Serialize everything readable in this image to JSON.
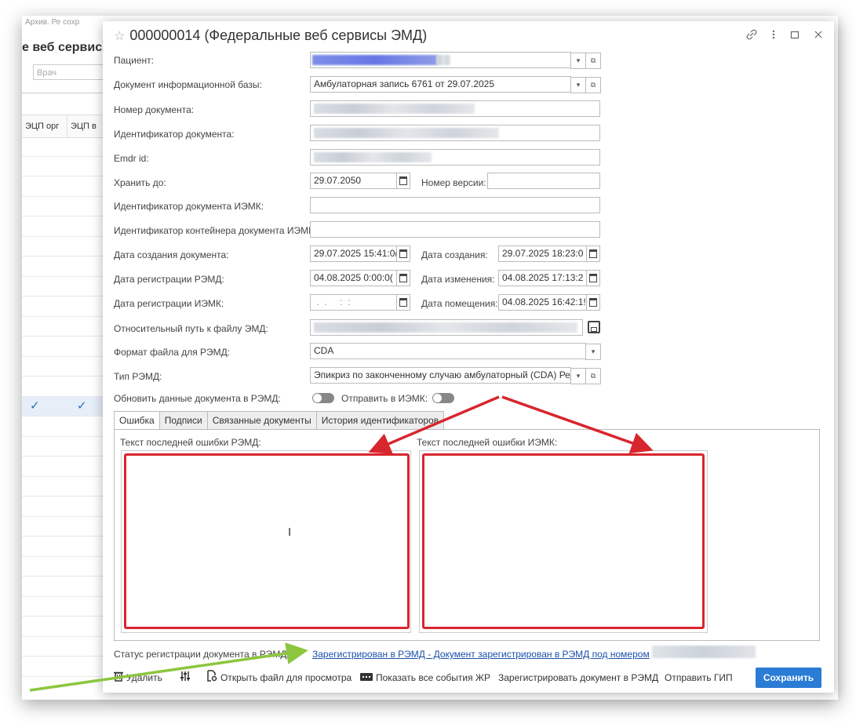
{
  "background": {
    "top_strip": "Архив. Ре сохр",
    "title": "е веб сервис",
    "filter_placeholder": "Врач",
    "columns": [
      "ЭЦП орг",
      "ЭЦП в"
    ],
    "checked_row_marks": [
      "✓",
      "✓"
    ]
  },
  "dialog": {
    "star_icon": "☆",
    "title": "000000014 (Федеральные веб сервисы ЭМД)",
    "controls": [
      "link-icon",
      "more-icon",
      "maximize-icon",
      "close-icon"
    ]
  },
  "fields": {
    "patient_label": "Пациент:",
    "base_doc_label": "Документ информационной базы:",
    "base_doc_value": "Амбулаторная запись 6761 от 29.07.2025",
    "doc_number_label": "Номер документа:",
    "doc_id_label": "Идентификатор документа:",
    "emdr_label": "Emdr id:",
    "keep_until_label": "Хранить до:",
    "keep_until_value": "29.07.2050",
    "version_label": "Номер версии:",
    "iemk_doc_id_label": "Идентификатор документа ИЭМК:",
    "iemk_container_label": "Идентификатор контейнера документа ИЭМК:",
    "created_label": "Дата создания документа:",
    "created_value": "29.07.2025 15:41:0(",
    "creation_date_label": "Дата создания:",
    "creation_date_value": "29.07.2025 18:23:0",
    "remd_reg_label": "Дата регистрации РЭМД:",
    "remd_reg_value": "04.08.2025  0:00:0(",
    "changed_label": "Дата изменения:",
    "changed_value": "04.08.2025 17:13:2",
    "iemk_reg_label": "Дата регистрации ИЭМК:",
    "iemk_reg_value": " .  .     :  :",
    "placed_label": "Дата помещения:",
    "placed_value": "04.08.2025 16:42:1!",
    "path_label": "Относительный путь к файлу ЭМД:",
    "format_label": "Формат файла для РЭМД:",
    "format_value": "CDA",
    "type_label": "Тип РЭМД:",
    "type_value": "Эпикриз по законченному случаю амбулаторный (CDA) Ред",
    "update_label": "Обновить данные документа в РЭМД:",
    "send_iemk_label": "Отправить в ИЭМК:"
  },
  "tabs": [
    "Ошибка",
    "Подписи",
    "Связанные документы",
    "История идентификаторов"
  ],
  "error_panel": {
    "remd_label": "Текст последней ошибки РЭМД:",
    "iemk_label": "Текст последней ошибки ИЭМК:"
  },
  "status": {
    "label": "Статус регистрации документа в РЭМД:",
    "link": "Зарегистрирован в РЭМД - Документ зарегистрирован в РЭМД под номером"
  },
  "toolbar": {
    "delete": "Удалить",
    "open_file": "Открыть файл для просмотра",
    "show_events": "Показать все события ЖР",
    "register": "Зарегистрировать документ в РЭМД",
    "send_gip": "Отправить ГИП",
    "save": "Сохранить"
  },
  "colors": {
    "accent": "#2a7cd5",
    "annotation_red": "#d8262e",
    "annotation_green": "#8cc63f",
    "link": "#1a4fa8"
  }
}
